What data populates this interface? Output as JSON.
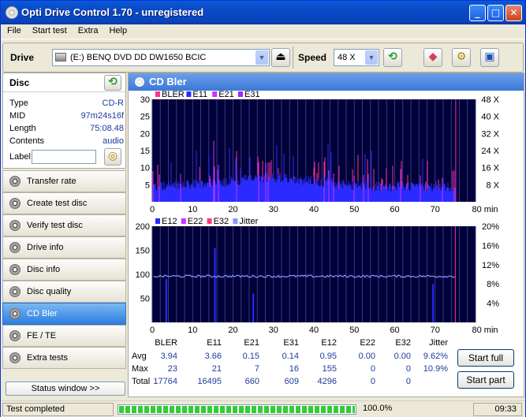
{
  "app": {
    "title": "Opti Drive Control 1.70 - unregistered"
  },
  "window_controls": {
    "minimize": "_",
    "maximize": "□",
    "close": "✕"
  },
  "menu": [
    "File",
    "Start test",
    "Extra",
    "Help"
  ],
  "toolbar": {
    "drive_label": "Drive",
    "drive_value": "(E:)  BENQ DVD DD DW1650 BCIC",
    "speed_label": "Speed",
    "speed_value": "48 X",
    "icons": [
      "eject-icon",
      "refresh-icon",
      "eraser-icon",
      "settings-icon",
      "save-icon"
    ]
  },
  "disc": {
    "title": "Disc",
    "type_label": "Type",
    "type": "CD-R",
    "mid_label": "MID",
    "mid": "97m24s16f",
    "length_label": "Length",
    "length": "75:08.48",
    "contents_label": "Contents",
    "contents": "audio",
    "label_label": "Label",
    "label_value": ""
  },
  "nav": [
    {
      "label": "Transfer rate"
    },
    {
      "label": "Create test disc"
    },
    {
      "label": "Verify test disc"
    },
    {
      "label": "Drive info"
    },
    {
      "label": "Disc info"
    },
    {
      "label": "Disc quality"
    },
    {
      "label": "CD Bler",
      "active": true
    },
    {
      "label": "FE / TE"
    },
    {
      "label": "Extra tests"
    }
  ],
  "status_window_button": "Status window >>",
  "panel": {
    "title": "CD Bler"
  },
  "chart_data": [
    {
      "type": "bar",
      "legend": [
        "BLER",
        "E11",
        "E21",
        "E31"
      ],
      "legend_colors": [
        "#ff3388",
        "#2b2bff",
        "#cc33ff",
        "#aa22ff"
      ],
      "x_ticks": [
        "0",
        "10",
        "20",
        "30",
        "40",
        "50",
        "60",
        "70",
        "80 min"
      ],
      "y_ticks_left": [
        "30",
        "25",
        "20",
        "15",
        "10",
        "5"
      ],
      "y_ticks_right": [
        "48 X",
        "40 X",
        "32 X",
        "24 X",
        "16 X",
        "8 X"
      ],
      "xlim": [
        0,
        80
      ],
      "ylim": [
        0,
        30
      ],
      "disc_end_min": 75.1,
      "summary": {
        "E11_avg": 3.66,
        "BLER_avg": 3.94,
        "BLER_max": 23,
        "E11_max": 21
      }
    },
    {
      "type": "bar",
      "legend": [
        "E12",
        "E22",
        "E32",
        "Jitter"
      ],
      "legend_colors": [
        "#2b2bff",
        "#cc33ff",
        "#ff3388",
        "#8899ff"
      ],
      "x_ticks": [
        "0",
        "10",
        "20",
        "30",
        "40",
        "50",
        "60",
        "70",
        "80 min"
      ],
      "y_ticks_left": [
        "200",
        "150",
        "100",
        "50"
      ],
      "y_ticks_right": [
        "20%",
        "16%",
        "12%",
        "8%",
        "4%"
      ],
      "xlim": [
        0,
        80
      ],
      "ylim": [
        0,
        200
      ],
      "jitter_pct_approx": 9.6,
      "e12_spikes": [
        {
          "x": 3.5,
          "y": 90
        },
        {
          "x": 15.5,
          "y": 155
        },
        {
          "x": 25,
          "y": 60
        },
        {
          "x": 69.5,
          "y": 80
        }
      ]
    }
  ],
  "stats": {
    "headers": [
      "BLER",
      "E11",
      "E21",
      "E31",
      "E12",
      "E22",
      "E32",
      "Jitter"
    ],
    "rows": [
      {
        "label": "Avg",
        "values": [
          "3.94",
          "3.66",
          "0.15",
          "0.14",
          "0.95",
          "0.00",
          "0.00",
          "9.62%"
        ]
      },
      {
        "label": "Max",
        "values": [
          "23",
          "21",
          "7",
          "16",
          "155",
          "0",
          "0",
          "10.9%"
        ]
      },
      {
        "label": "Total",
        "values": [
          "17764",
          "16495",
          "660",
          "609",
          "4296",
          "0",
          "0",
          ""
        ]
      }
    ]
  },
  "buttons": {
    "start_full": "Start full",
    "start_part": "Start part"
  },
  "statusbar": {
    "text": "Test completed",
    "progress": "100.0%",
    "progress_fraction": 1.0,
    "time": "09:33"
  }
}
